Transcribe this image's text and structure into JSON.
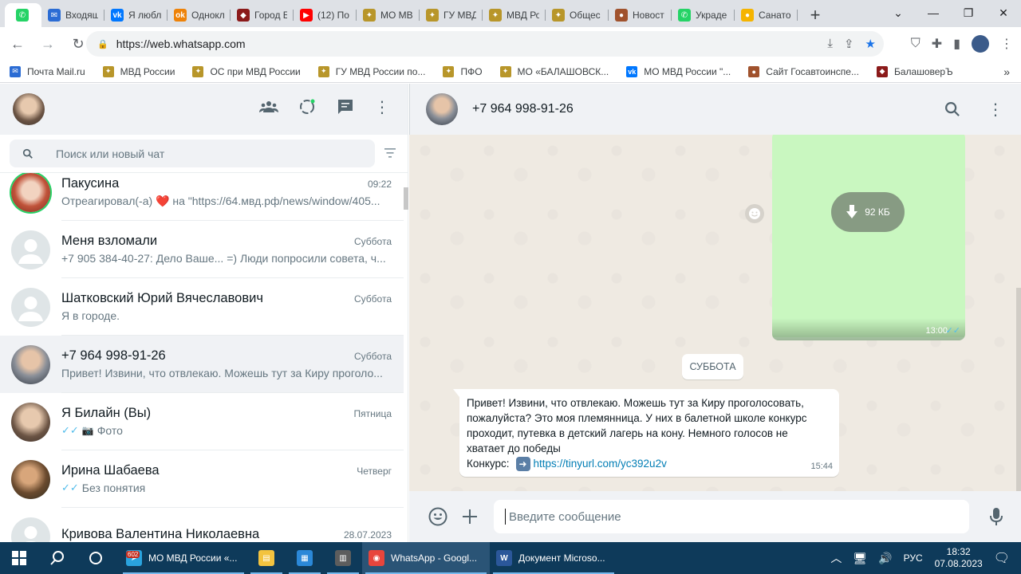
{
  "browser": {
    "tabs": [
      {
        "label": "",
        "icon": "whatsapp-icon",
        "color": "#25d366",
        "active": true
      },
      {
        "label": "Входящ",
        "icon": "mail-icon",
        "color": "#2b6cd4"
      },
      {
        "label": "Я любл",
        "icon": "vk-icon",
        "color": "#0077ff"
      },
      {
        "label": "Однокл",
        "icon": "ok-icon",
        "color": "#ee8208"
      },
      {
        "label": "Город Б",
        "icon": "city-icon",
        "color": "#8b1a1a"
      },
      {
        "label": "(12) По",
        "icon": "youtube-icon",
        "color": "#ff0000"
      },
      {
        "label": "МО МВ",
        "icon": "mvd-icon",
        "color": "#b8962a"
      },
      {
        "label": "ГУ МВД",
        "icon": "mvd-icon",
        "color": "#b8962a"
      },
      {
        "label": "МВД Ро",
        "icon": "mvd-icon",
        "color": "#b8962a"
      },
      {
        "label": "Общес",
        "icon": "mvd-icon",
        "color": "#b8962a"
      },
      {
        "label": "Новост",
        "icon": "news-icon",
        "color": "#a0522d"
      },
      {
        "label": "Украде",
        "icon": "whatsapp-icon",
        "color": "#25d366"
      },
      {
        "label": "Санато",
        "icon": "sun-icon",
        "color": "#f5b400"
      }
    ],
    "url": "https://web.whatsapp.com",
    "bookmarks": [
      {
        "label": "Почта Mail.ru",
        "icon": "mail-icon",
        "color": "#2b6cd4"
      },
      {
        "label": "МВД России",
        "icon": "mvd-icon",
        "color": "#b8962a"
      },
      {
        "label": "ОС при МВД России",
        "icon": "mvd-icon",
        "color": "#b8962a"
      },
      {
        "label": "ГУ МВД России по...",
        "icon": "mvd-icon",
        "color": "#b8962a"
      },
      {
        "label": "ПФО",
        "icon": "mvd-icon",
        "color": "#b8962a"
      },
      {
        "label": "МО «БАЛАШОВСК...",
        "icon": "mvd-icon",
        "color": "#b8962a"
      },
      {
        "label": "МО МВД России \"...",
        "icon": "vk-icon",
        "color": "#0077ff"
      },
      {
        "label": "Сайт Госавтоинспе...",
        "icon": "gibdd-icon",
        "color": "#a0522d"
      },
      {
        "label": "БалашоверЪ",
        "icon": "city-icon",
        "color": "#8b1a1a"
      }
    ]
  },
  "sidebar": {
    "search_placeholder": "Поиск или новый чат",
    "chats": [
      {
        "name": "Пакусина",
        "time": "09:22",
        "preview": "Отреагировал(-а) ❤️ на \"https://64.мвд.рф/news/window/405...",
        "avatar": "photo-woman-red"
      },
      {
        "name": "Меня взломали",
        "time": "Суббота",
        "preview": "+7 905 384-40-27: Дело Ваше... =) Люди попросили совета, ч...",
        "avatar": "group-placeholder"
      },
      {
        "name": "Шатковский Юрий Вячеславович",
        "time": "Суббота",
        "preview": "Я в городе.",
        "avatar": "user-placeholder"
      },
      {
        "name": "+7 964 998-91-26",
        "time": "Суббота",
        "preview": "Привет! Извини, что отвлекаю. Можешь тут за Киру проголо...",
        "avatar": "photo-man-grey",
        "selected": true
      },
      {
        "name": "Я Билайн (Вы)",
        "time": "Пятница",
        "preview": "Фото",
        "avatar": "photo-man-self",
        "ticks": true,
        "camera": true
      },
      {
        "name": "Ирина Шабаева",
        "time": "Четверг",
        "preview": "Без понятия",
        "avatar": "photo-woman-outdoor",
        "ticks": true
      },
      {
        "name": "Кривова Валентина Николаевна",
        "time": "28.07.2023",
        "preview": "",
        "avatar": "user-placeholder"
      }
    ]
  },
  "conversation": {
    "contact": "+7 964 998-91-26",
    "media": {
      "size": "92 КБ",
      "time": "13:00"
    },
    "date_divider": "СУББОТА",
    "message": {
      "text": "Привет! Извини, что отвлекаю. Можешь тут за Киру проголосовать, пожалуйста? Это моя племянница. У них в балетной школе конкурс проходит, путевка в детский лагерь на кону.  Немного голосов не хватает до победы",
      "link_prefix": "Конкурс:",
      "link": "https://tinyurl.com/yc392u2v",
      "time": "15:44"
    },
    "input_placeholder": "Введите сообщение"
  },
  "taskbar": {
    "apps": [
      {
        "label": "МО МВД России «...",
        "icon": "telegram-icon",
        "color": "#2aa3de",
        "badge": "602"
      },
      {
        "label": "",
        "icon": "file-explorer-icon",
        "color": "#f3c33f"
      },
      {
        "label": "",
        "icon": "store-icon",
        "color": "#2b88d8"
      },
      {
        "label": "",
        "icon": "calculator-icon",
        "color": "#5d5d5d"
      },
      {
        "label": "WhatsApp - Googl...",
        "icon": "chrome-icon",
        "color": "#e8453c",
        "active": true
      },
      {
        "label": "Документ Microso...",
        "icon": "word-icon",
        "color": "#2b579a"
      }
    ],
    "language": "РУС",
    "time": "18:32",
    "date": "07.08.2023"
  },
  "colors": {
    "whatsapp_green": "#25d366",
    "bubble_out": "#d9fdd3",
    "link": "#027eb5",
    "tick_blue": "#53bdeb"
  }
}
